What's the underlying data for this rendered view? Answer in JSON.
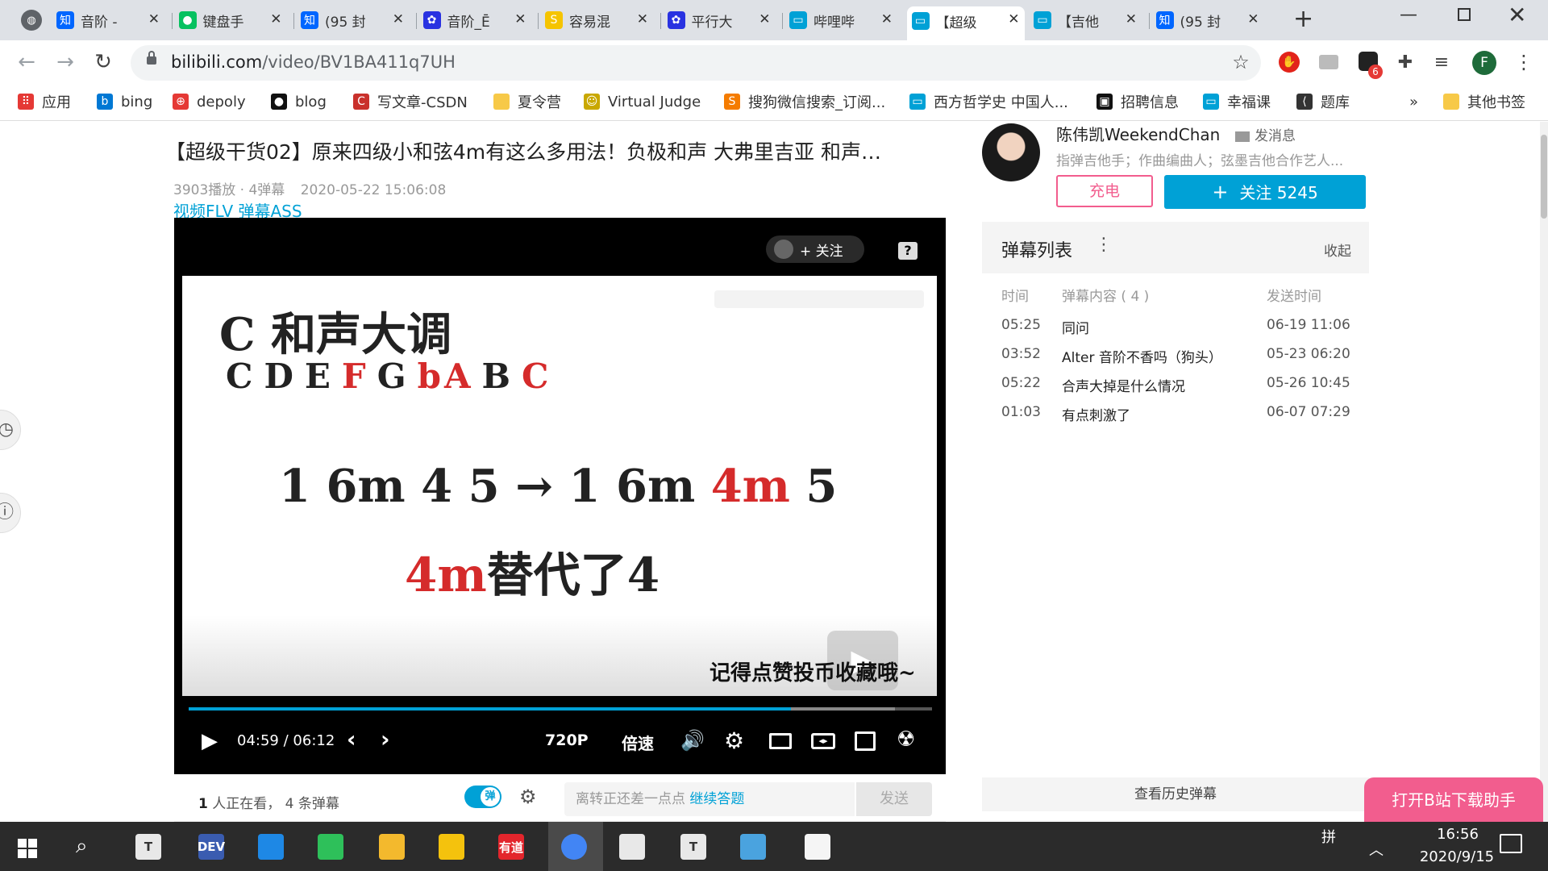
{
  "tabs": [
    {
      "label": "音阶 -",
      "icon": "zhihu-icon",
      "fav": "知",
      "color": "#0066ff"
    },
    {
      "label": "键盘手",
      "icon": "wechat-icon",
      "fav": "",
      "color": "#07c160"
    },
    {
      "label": "(95 封",
      "icon": "zhihu-icon",
      "fav": "知",
      "color": "#0066ff"
    },
    {
      "label": "音阶_Ē",
      "icon": "baidu-icon",
      "fav": "",
      "color": "#2932e1"
    },
    {
      "label": "容易混",
      "icon": "sogou-icon",
      "fav": "S",
      "color": "#f5c400"
    },
    {
      "label": "平行大",
      "icon": "baidu-icon",
      "fav": "",
      "color": "#2932e1"
    },
    {
      "label": "哔哩哔",
      "icon": "bilibili-icon",
      "fav": "",
      "color": "#00a1d6"
    },
    {
      "label": "【超级",
      "icon": "bilibili-icon",
      "fav": "",
      "color": "#00a1d6"
    },
    {
      "label": "【吉他",
      "icon": "bilibili-icon",
      "fav": "",
      "color": "#00a1d6"
    },
    {
      "label": "(95 封",
      "icon": "zhihu-icon",
      "fav": "知",
      "color": "#0066ff"
    }
  ],
  "address": {
    "domain": "bilibili.com",
    "path": "/video/BV1BA411q7UH"
  },
  "bookmarks": [
    {
      "label": "应用",
      "icon": "apps-grid-icon"
    },
    {
      "label": "bing",
      "icon": "bing-icon"
    },
    {
      "label": "depoly",
      "icon": "deploy-icon"
    },
    {
      "label": "blog",
      "icon": "github-icon"
    },
    {
      "label": "写文章-CSDN",
      "icon": "csdn-icon"
    },
    {
      "label": "夏令营",
      "icon": "folder-icon"
    },
    {
      "label": "Virtual Judge",
      "icon": "vjudge-icon"
    },
    {
      "label": "搜狗微信搜索_订阅...",
      "icon": "sogou-icon"
    },
    {
      "label": "西方哲学史 中国人...",
      "icon": "bilibili-icon"
    },
    {
      "label": "招聘信息",
      "icon": "job-icon"
    },
    {
      "label": "幸福课",
      "icon": "bilibili-icon"
    },
    {
      "label": "题库",
      "icon": "leetcode-icon"
    },
    {
      "label": "»",
      "icon": "more-icon"
    },
    {
      "label": "其他书签",
      "icon": "folder-icon"
    }
  ],
  "extensions": {
    "badge": "6",
    "avatar": "F"
  },
  "video": {
    "title": "【超级干货02】原来四级小和弦4m有这么多用法！负极和声 大弗里吉亚 和声…",
    "plays": "3903播放 · 4弹幕",
    "date": "2020-05-22 15:06:08",
    "links": "视频FLV 弹幕ASS",
    "follow_overlay": "+ 关注",
    "help": "?",
    "slide_title": "C 和声大调",
    "notes": [
      {
        "t": "C",
        "red": false
      },
      {
        "t": "D",
        "red": false
      },
      {
        "t": "E",
        "red": false
      },
      {
        "t": "F",
        "red": true
      },
      {
        "t": "G",
        "red": false
      },
      {
        "t": "bA",
        "red": true
      },
      {
        "t": "B",
        "red": false
      },
      {
        "t": "C",
        "red": true
      }
    ],
    "prog_left": "1 6m 4 5 → 1 6m ",
    "prog_red": "4m",
    "prog_end": " 5",
    "sub_red": "4m",
    "sub_black": "替代了4",
    "watermark": "记得点赞投币收藏哦~",
    "current_time": "04:59",
    "time_sep": "/",
    "total_time": "06:12",
    "quality": "720P",
    "speed": "倍速",
    "progress": 0.81,
    "buffered": 0.95,
    "watching_count": "1",
    "watching_text": " 人正在看，",
    "danmaku_count": "4",
    "danmaku_text": " 条弹幕",
    "danmaku_toggle": "弹",
    "input_placeholder": "离转正还差一点点",
    "input_link": "继续答题",
    "send": "发送"
  },
  "uploader": {
    "name": "陈伟凯WeekendChan",
    "message": "发消息",
    "desc": "指弹吉他手；作曲编曲人；弦墨吉他合作艺人...",
    "charge": "充电",
    "follow": "关注 5245"
  },
  "danmaku_list": {
    "title": "弹幕列表",
    "collapse": "收起",
    "headers": [
      "时间",
      "弹幕内容 ( 4 )",
      "发送时间"
    ],
    "rows": [
      {
        "time": "05:25",
        "content": "同问",
        "sent": "06-19 11:06"
      },
      {
        "time": "03:52",
        "content": "Alter 音阶不香吗（狗头）",
        "sent": "05-23 06:20"
      },
      {
        "time": "05:22",
        "content": "合声大掉是什么情况",
        "sent": "05-26 10:45"
      },
      {
        "time": "01:03",
        "content": "有点刺激了",
        "sent": "06-07 07:29"
      }
    ],
    "history": "查看历史弹幕"
  },
  "download_btn": "打开B站下载助手",
  "taskbar": {
    "ime": "拼",
    "time": "16:56",
    "date": "2020/9/15",
    "apps": [
      {
        "name": "typora-icon",
        "fav": "T",
        "color": "#e8e8e8"
      },
      {
        "name": "devcpp-icon",
        "fav": "DEV",
        "color": "#3a5cb0"
      },
      {
        "name": "vscode-icon",
        "fav": "",
        "color": "#1e88e5"
      },
      {
        "name": "wechat-icon",
        "fav": "",
        "color": "#2ec05a"
      },
      {
        "name": "file-explorer-icon",
        "fav": "",
        "color": "#f3b92d"
      },
      {
        "name": "app-yellow-icon",
        "fav": "",
        "color": "#f4c20d"
      },
      {
        "name": "youdao-icon",
        "fav": "有道",
        "color": "#e3252c"
      },
      {
        "name": "chrome-icon",
        "fav": "",
        "color": "#4285f4"
      },
      {
        "name": "reader-icon",
        "fav": "",
        "color": "#e8e8e8"
      },
      {
        "name": "typora-icon",
        "fav": "T",
        "color": "#e8e8e8"
      },
      {
        "name": "remote-desktop-icon",
        "fav": "",
        "color": "#4aa3df"
      },
      {
        "name": "notepad-icon",
        "fav": "",
        "color": "#f5f5f5"
      }
    ]
  }
}
